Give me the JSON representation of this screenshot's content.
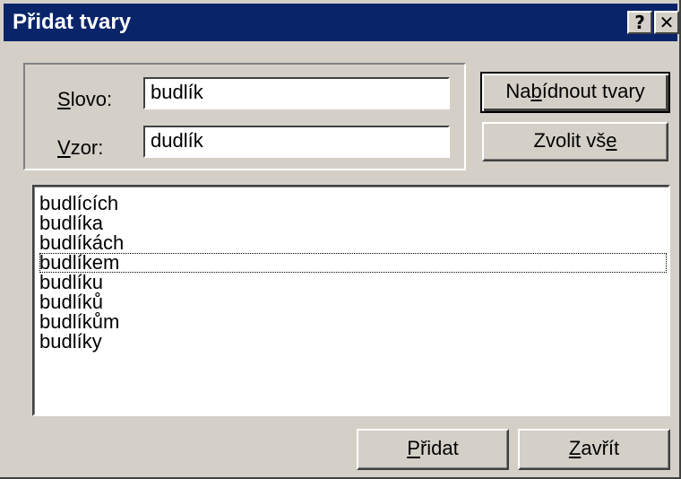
{
  "window": {
    "title": "Přidat tvary",
    "help_button": "?",
    "close_button": "✕"
  },
  "form": {
    "word_label_mnemonic": "S",
    "word_label_rest": "lovo:",
    "word_value": "budlík",
    "pattern_label_mnemonic": "V",
    "pattern_label_rest": "zor:",
    "pattern_value": "dudlík"
  },
  "buttons": {
    "suggest_before": "Na",
    "suggest_mnemonic": "b",
    "suggest_after": "ídnout tvary",
    "select_all_before": "Zvolit vš",
    "select_all_mnemonic": "e",
    "select_all_after": "",
    "add_mnemonic": "P",
    "add_after": "řidat",
    "close_mnemonic": "Z",
    "close_after": "avřít"
  },
  "forms_list": {
    "focused_index": 3,
    "items": [
      "budlících",
      "budlíka",
      "budlíkách",
      "budlíkem",
      "budlíku",
      "budlíků",
      "budlíkům",
      "budlíky"
    ]
  }
}
